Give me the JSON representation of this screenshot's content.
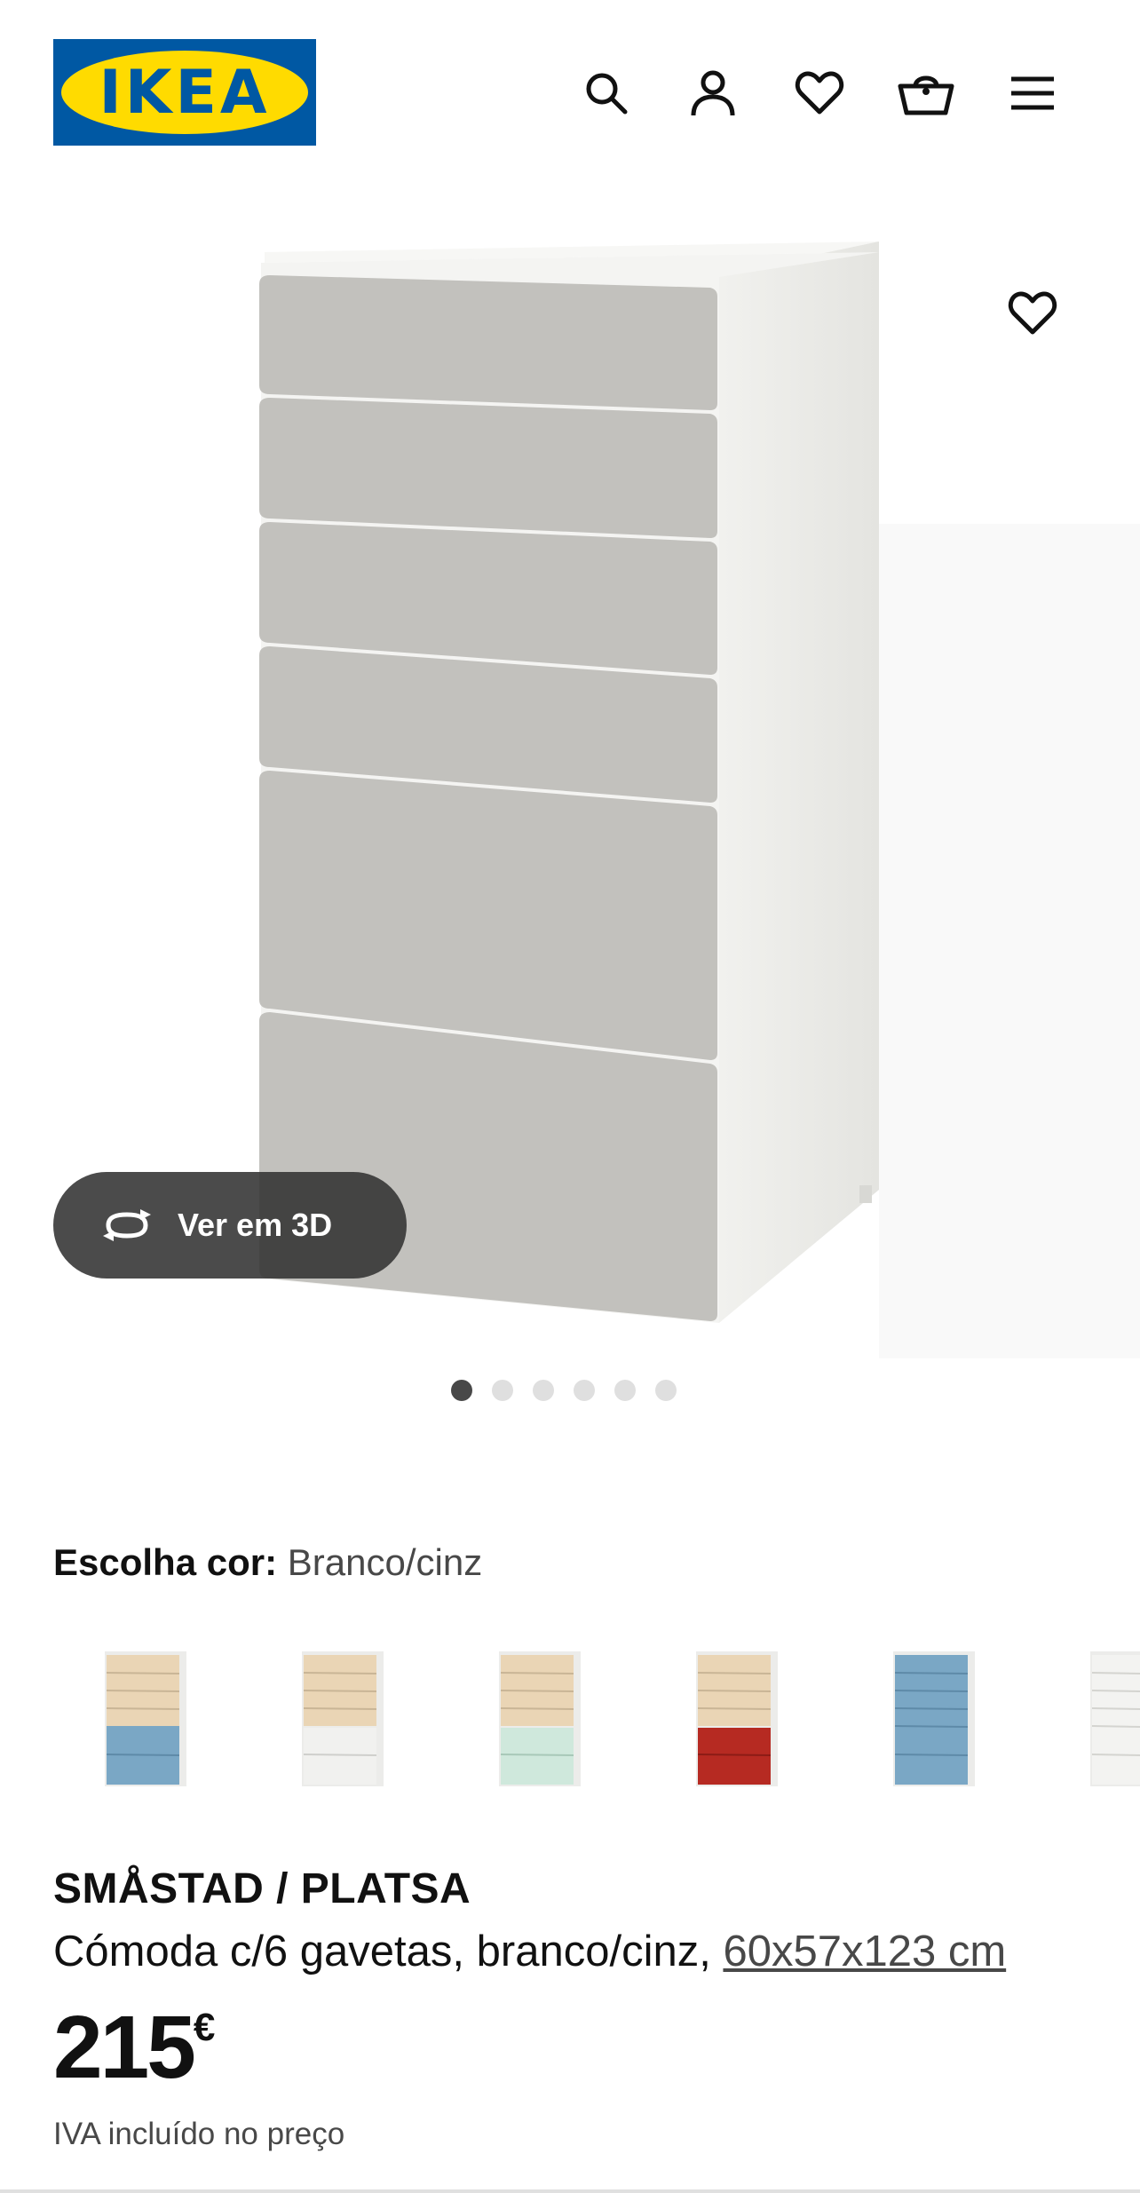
{
  "header": {
    "logo_text": "IKEA",
    "icons": [
      "search-icon",
      "account-icon",
      "heart-icon",
      "basket-icon",
      "menu-icon"
    ]
  },
  "gallery": {
    "view3d_label": "Ver em 3D",
    "dots_count": 6,
    "active_dot": 1
  },
  "color_selector": {
    "label": "Escolha cor:",
    "value": "Branco/cinz",
    "swatches": [
      "birch/blue",
      "birch/white",
      "birch/mint",
      "birch/red",
      "blue",
      "white"
    ]
  },
  "product": {
    "name": "SMÅSTAD / PLATSA",
    "description": "Cómoda c/6 gavetas, branco/cinz, ",
    "dimensions": "60x57x123 cm",
    "price": "215",
    "currency": "€",
    "vat_note": "IVA incluído no preço"
  },
  "colors": {
    "ikea_blue": "#0058a3",
    "ikea_yellow": "#ffdb00",
    "drawer_grey": "#c2c1bd"
  }
}
